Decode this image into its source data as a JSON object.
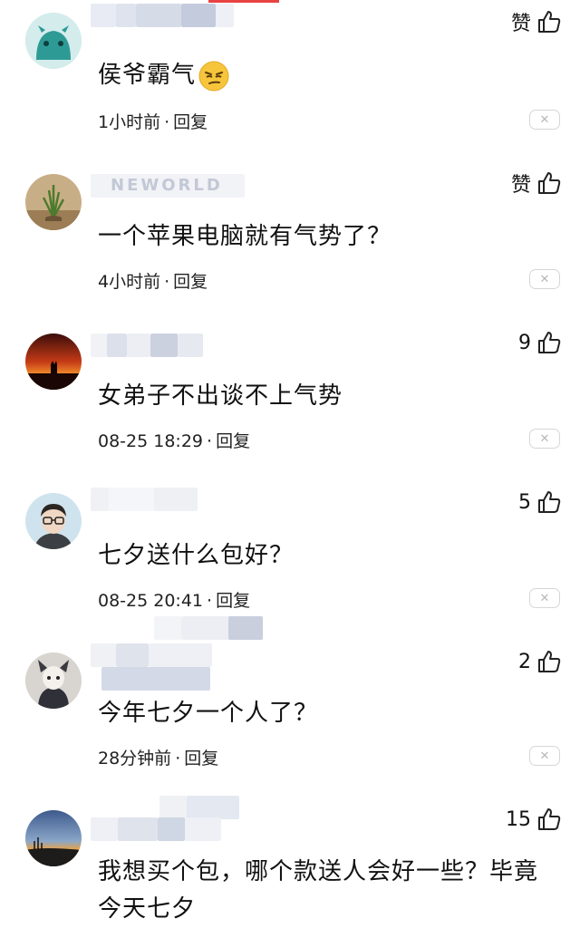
{
  "comments": [
    {
      "avatar": "teal-monster-avatar",
      "text": "侯爷霸气",
      "emoji": "smirking-face-emoji",
      "time": "1小时前",
      "reply_label": "回复",
      "likes": "赞",
      "watermark_text": ""
    },
    {
      "avatar": "plant-photo-avatar",
      "text": "一个苹果电脑就有气势了？",
      "time": "4小时前",
      "reply_label": "回复",
      "likes": "赞",
      "watermark_text": "NEWORLD"
    },
    {
      "avatar": "sunset-silhouette-avatar",
      "text": "女弟子不出谈不上气势",
      "time": "08-25 18:29",
      "reply_label": "回复",
      "likes": "9"
    },
    {
      "avatar": "glasses-man-avatar",
      "text": "七夕送什么包好？",
      "time": "08-25 20:41",
      "reply_label": "回复",
      "likes": "5"
    },
    {
      "avatar": "cartoon-character-avatar",
      "text": "今年七夕一个人了？",
      "time": "28分钟前",
      "reply_label": "回复",
      "likes": "2"
    },
    {
      "avatar": "landscape-sunset-avatar",
      "text": "我想买个包，哪个款送人会好一些？毕竟今天七夕",
      "likes": "15"
    }
  ],
  "separator": "·",
  "close_glyph": "✕",
  "colors": {
    "accent": "#e84242",
    "meta_text": "#222222",
    "close_border": "#d6d6d6"
  }
}
